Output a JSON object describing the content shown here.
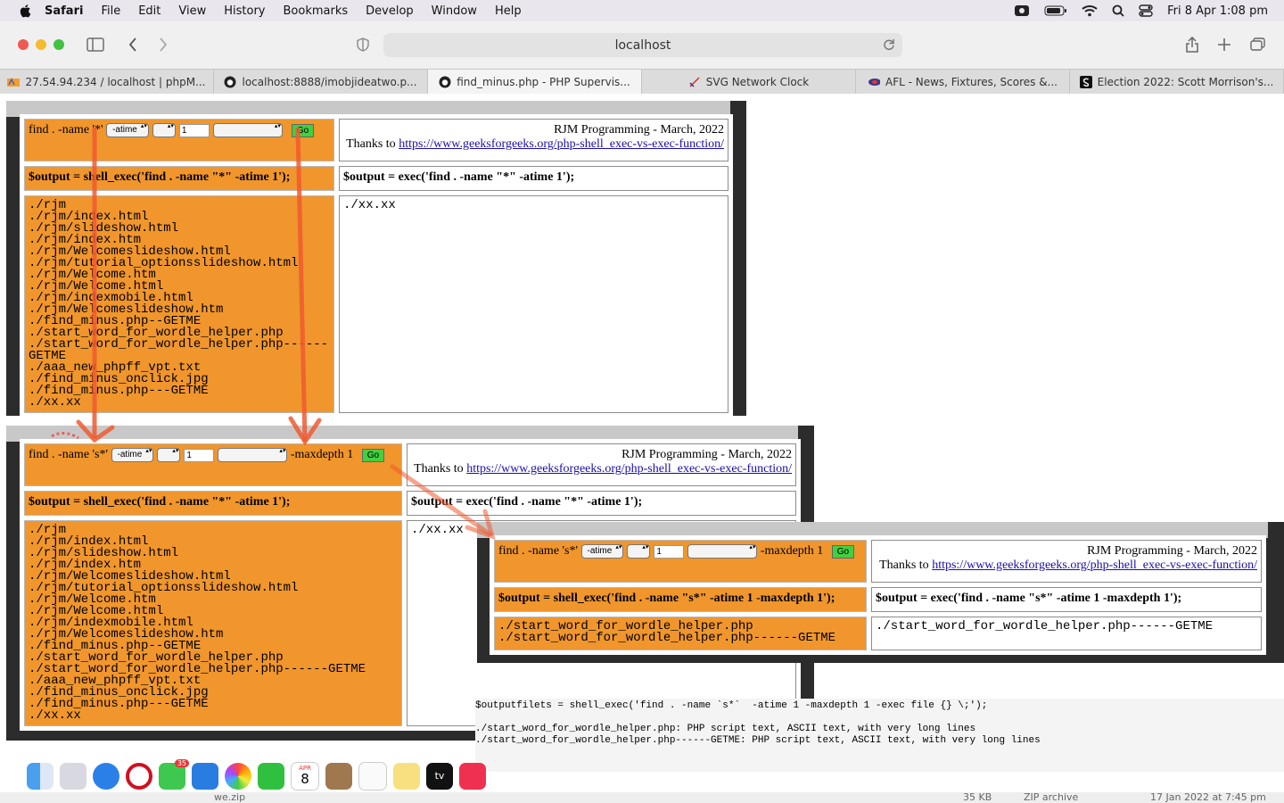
{
  "menubar": {
    "app": "Safari",
    "items": [
      "File",
      "Edit",
      "View",
      "History",
      "Bookmarks",
      "Develop",
      "Window",
      "Help"
    ],
    "clock": "Fri 8 Apr  1:08 pm"
  },
  "toolbar": {
    "address": "localhost"
  },
  "tabs": [
    {
      "label": "27.54.94.234 / localhost | phpM...",
      "icon": "phpmyadmin-icon"
    },
    {
      "label": "localhost:8888/imobjideatwo.p...",
      "icon": "github-icon"
    },
    {
      "label": "find_minus.php - PHP Supervis...",
      "icon": "github-icon",
      "active": true
    },
    {
      "label": "SVG Network Clock",
      "icon": "clock-icon"
    },
    {
      "label": "AFL - News, Fixtures, Scores &...",
      "icon": "afl-icon"
    },
    {
      "label": "Election 2022: Scott Morrison's...",
      "icon": "news-icon"
    }
  ],
  "common": {
    "heading": "RJM Programming - March, 2022",
    "thanks": "Thanks to",
    "link": "https://www.geeksforgeeks.org/php-shell_exec-vs-exec-function/",
    "time_select": "-atime",
    "num_value": "1",
    "go": "Go",
    "maxdepth": "-maxdepth 1"
  },
  "win1": {
    "prefix": "find . -name '*'",
    "shell_cmd": "$output = shell_exec('find . -name \"*\" -atime 1');",
    "exec_cmd": "$output = exec('find . -name \"*\" -atime 1');",
    "shell_lines": [
      "./rjm",
      "./rjm/index.html",
      "./rjm/slideshow.html",
      "./rjm/index.htm",
      "./rjm/Welcomeslideshow.html",
      "./rjm/tutorial_optionsslideshow.html",
      "./rjm/Welcome.htm",
      "./rjm/Welcome.html",
      "./rjm/indexmobile.html",
      "./rjm/Welcomeslideshow.htm",
      "./find_minus.php--GETME",
      "./start_word_for_wordle_helper.php",
      "./start_word_for_wordle_helper.php------GETME",
      "./aaa_new_phpff_vpt.txt",
      "./find_minus_onclick.jpg",
      "./find_minus.php---GETME",
      "./xx.xx"
    ],
    "exec_lines": [
      "./xx.xx"
    ]
  },
  "win2": {
    "prefix": "find . -name 's*'",
    "shell_cmd": "$output = shell_exec('find . -name \"*\" -atime 1');",
    "exec_cmd": "$output = exec('find . -name \"*\" -atime 1');",
    "shell_lines": [
      "./rjm",
      "./rjm/index.html",
      "./rjm/slideshow.html",
      "./rjm/index.htm",
      "./rjm/Welcomeslideshow.html",
      "./rjm/tutorial_optionsslideshow.html",
      "./rjm/Welcome.htm",
      "./rjm/Welcome.html",
      "./rjm/indexmobile.html",
      "./rjm/Welcomeslideshow.htm",
      "./find_minus.php--GETME",
      "./start_word_for_wordle_helper.php",
      "./start_word_for_wordle_helper.php------GETME",
      "./aaa_new_phpff_vpt.txt",
      "./find_minus_onclick.jpg",
      "./find_minus.php---GETME",
      "./xx.xx"
    ],
    "exec_lines": [
      "./xx.xx"
    ]
  },
  "win3": {
    "prefix": "find . -name 's*'",
    "shell_cmd": "$output = shell_exec('find . -name \"s*\" -atime 1 -maxdepth 1');",
    "exec_cmd": "$output = exec('find . -name \"s*\" -atime 1 -maxdepth 1');",
    "shell_lines": [
      "./start_word_for_wordle_helper.php",
      "./start_word_for_wordle_helper.php------GETME"
    ],
    "exec_lines": [
      "./start_word_for_wordle_helper.php------GETME"
    ]
  },
  "fileout": {
    "command": "$outputfilets = shell_exec('find . -name `s*`  -atime 1 -maxdepth 1 -exec file {} \\;');",
    "lines": [
      "./start_word_for_wordle_helper.php: PHP script text, ASCII text, with very long lines",
      "./start_word_for_wordle_helper.php------GETME: PHP script text, ASCII text, with very long lines"
    ]
  },
  "dock": {
    "messages_badge": "35",
    "calendar_month": "APR",
    "calendar_day": "8"
  },
  "finder": {
    "file": "we.zip",
    "size": "35 KB",
    "kind": "ZIP archive",
    "date": "17 Jan 2022 at 7:45 pm"
  },
  "colors": {
    "panel_orange": "#f0962c",
    "frame_dark": "#2c2c2c",
    "arrow": "#f05a30"
  }
}
